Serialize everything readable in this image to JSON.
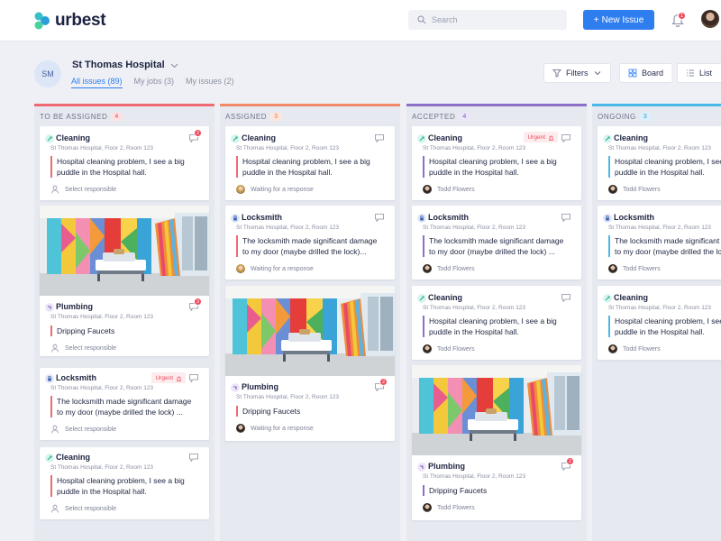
{
  "app": {
    "brand": "urbest"
  },
  "colors": {
    "accent": "#2f7ef0",
    "urgent": "#ef4a5a",
    "cleaning": "#26c2a0",
    "locksmith": "#3d5fb0",
    "plumbing": "#9a7fd3"
  },
  "header": {
    "search_placeholder": "Search",
    "new_issue_label": "New Issue",
    "notification_count": "1"
  },
  "org": {
    "initials": "SM",
    "name": "St Thomas Hospital",
    "tabs": [
      {
        "label": "All issues (89)",
        "active": true
      },
      {
        "label": "My jobs (3)",
        "active": false
      },
      {
        "label": "My issues (2)",
        "active": false
      }
    ]
  },
  "toolbar": {
    "filters_label": "Filters",
    "board_label": "Board",
    "list_label": "List"
  },
  "columns": [
    {
      "title": "TO BE ASSIGNED",
      "count": "4",
      "color": "#ef6a73"
    },
    {
      "title": "ASSIGNED",
      "count": "3",
      "color": "#f08a6a"
    },
    {
      "title": "ACCEPTED",
      "count": "4",
      "color": "#8b6fc9"
    },
    {
      "title": "ONGOING",
      "count": "3",
      "color": "#4cb8e8"
    }
  ],
  "cards": {
    "c1": {
      "title": "Cleaning",
      "location": "St Thomas Hospital, Floor 2, Room 123",
      "description": "Hospital cleaning problem, I see a big\npuddle in the Hospital hall.",
      "footer": "Select responsible",
      "badge": "2"
    },
    "c2": {
      "title": "Plumbing",
      "location": "St Thomas Hospital, Floor 2, Room 123",
      "description": "Dripping Faucets",
      "footer": "Select responsible",
      "badge": "3"
    },
    "c3": {
      "title": "Locksmith",
      "location": "St Thomas Hospital, Floor 2, Room 123",
      "description": "The locksmith made significant damage\nto my door (maybe drilled the lock) ...",
      "footer": "Select responsible",
      "urgent": "Urgent"
    },
    "c4": {
      "title": "Cleaning",
      "location": "St Thomas Hospital, Floor 2, Room 123",
      "description": "Hospital cleaning problem, I see a big\npuddle in the Hospital hall.",
      "footer": "Select responsible"
    },
    "a1": {
      "title": "Cleaning",
      "location": "St Thomas Hospital, Floor 2, Room 123",
      "description": "Hospital cleaning problem, I see a big\npuddle in the Hospital hall.",
      "footer": "Waiting for a response"
    },
    "a2": {
      "title": "Locksmith",
      "location": "St Thomas Hospital, Floor 2, Room 123",
      "description": "The locksmith made significant damage\nto my door (maybe drilled the lock)...",
      "footer": "Waiting for a response"
    },
    "a3": {
      "title": "Plumbing",
      "location": "St Thomas Hospital, Floor 2, Room 123",
      "description": "Dripping Faucets",
      "footer": "Waiting for a response",
      "badge": "2"
    },
    "p1": {
      "title": "Cleaning",
      "location": "St Thomas Hospital, Floor 2, Room 123",
      "description": "Hospital cleaning problem, I see a big\npuddle in the Hospital hall.",
      "footer": "Todd Flowers",
      "urgent": "Urgent"
    },
    "p2": {
      "title": "Locksmith",
      "location": "St Thomas Hospital, Floor 2, Room 123",
      "description": "The locksmith made significant damage\nto my door (maybe drilled the lock) ...",
      "footer": "Todd Flowers"
    },
    "p3": {
      "title": "Cleaning",
      "location": "St Thomas Hospital, Floor 2, Room 123",
      "description": "Hospital cleaning problem, I see a big\npuddle in the Hospital hall.",
      "footer": "Todd Flowers"
    },
    "p4": {
      "title": "Plumbing",
      "location": "St Thomas Hospital, Floor 2, Room 123",
      "description": "Dripping Faucets",
      "footer": "Todd Flowers",
      "badge": "2"
    },
    "o1": {
      "title": "Cleaning",
      "location": "St Thomas Hospital, Floor 2, Room 123",
      "description": "Hospital cleaning problem, I see a big\npuddle in the Hospital hall.",
      "footer": "Todd Flowers"
    },
    "o2": {
      "title": "Locksmith",
      "location": "St Thomas Hospital, Floor 2, Room 123",
      "description": "The locksmith made significant damage\nto my door (maybe drilled the lock) ...",
      "footer": "Todd Flowers"
    },
    "o3": {
      "title": "Cleaning",
      "location": "St Thomas Hospital, Floor 2, Room 123",
      "description": "Hospital cleaning problem, I see a big\npuddle in the Hospital hall.",
      "footer": "Todd Flowers"
    }
  }
}
